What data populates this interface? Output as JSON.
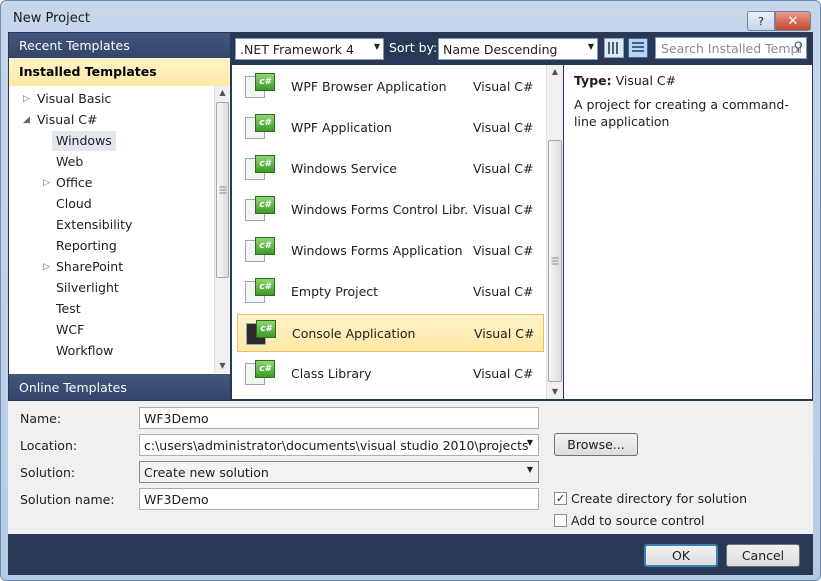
{
  "window": {
    "title": "New Project",
    "help_label": "?",
    "close_label": "✕"
  },
  "sidebar": {
    "recent_header": "Recent Templates",
    "installed_header": "Installed Templates",
    "online_header": "Online Templates",
    "items": [
      {
        "label": "Visual Basic",
        "arrow": "▷"
      },
      {
        "label": "Visual C#",
        "arrow": "◢"
      },
      {
        "label": "Windows"
      },
      {
        "label": "Web"
      },
      {
        "label": "Office",
        "arrow": "▷"
      },
      {
        "label": "Cloud"
      },
      {
        "label": "Extensibility"
      },
      {
        "label": "Reporting"
      },
      {
        "label": "SharePoint",
        "arrow": "▷"
      },
      {
        "label": "Silverlight"
      },
      {
        "label": "Test"
      },
      {
        "label": "WCF"
      },
      {
        "label": "Workflow"
      }
    ]
  },
  "toolbar": {
    "framework": ".NET Framework 4",
    "sort_label": "Sort by:",
    "sort_value": "Name Descending",
    "search_placeholder": "Search Installed Templ"
  },
  "templates": [
    {
      "name": "WPF Browser Application",
      "lang": "Visual C#"
    },
    {
      "name": "WPF Application",
      "lang": "Visual C#"
    },
    {
      "name": "Windows Service",
      "lang": "Visual C#"
    },
    {
      "name": "Windows Forms Control Libr...",
      "lang": "Visual C#"
    },
    {
      "name": "Windows Forms Application",
      "lang": "Visual C#"
    },
    {
      "name": "Empty Project",
      "lang": "Visual C#"
    },
    {
      "name": "Console Application",
      "lang": "Visual C#"
    },
    {
      "name": "Class Library",
      "lang": "Visual C#"
    }
  ],
  "details": {
    "type_label": "Type:",
    "type_value": "Visual C#",
    "description": "A project for creating a command-line application"
  },
  "form": {
    "name_label": "Name:",
    "name_value": "WF3Demo",
    "location_label": "Location:",
    "location_value": "c:\\users\\administrator\\documents\\visual studio 2010\\projects",
    "browse_label": "Browse...",
    "solution_label": "Solution:",
    "solution_value": "Create new solution",
    "solution_name_label": "Solution name:",
    "solution_name_value": "WF3Demo",
    "create_dir_label": "Create directory for solution",
    "create_dir_checked": true,
    "source_control_label": "Add to source control",
    "source_control_checked": false
  },
  "buttons": {
    "ok": "OK",
    "cancel": "Cancel"
  },
  "colors": {
    "frame_dark": "#293955",
    "selection": "#ffe8a6"
  }
}
